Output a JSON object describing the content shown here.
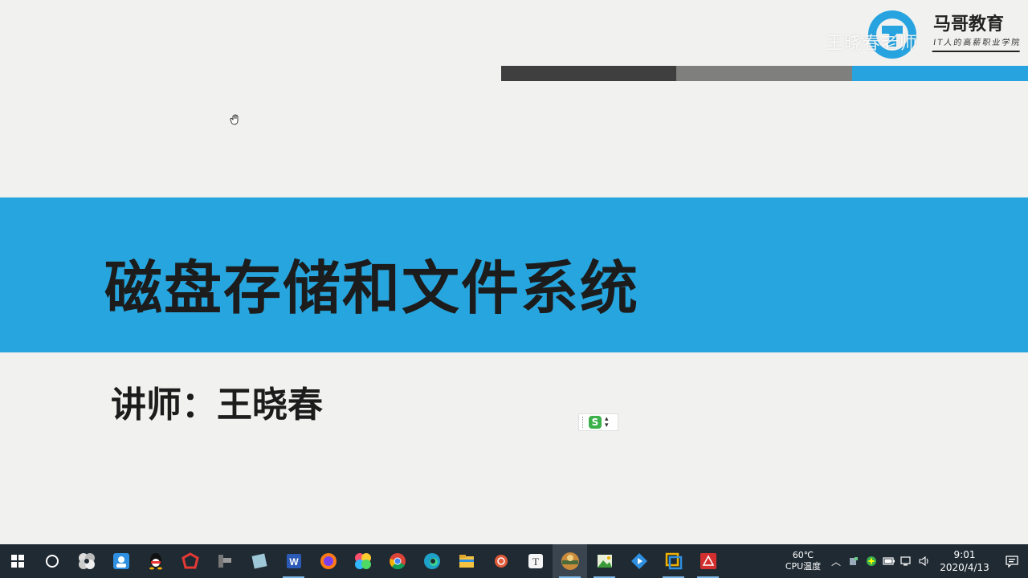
{
  "slide": {
    "title": "磁盘存储和文件系统",
    "lecturer": "讲师：王晓春",
    "watermark": "王晓春老师",
    "brand": {
      "name": "马哥教育",
      "slogan": "IT人的高薪职业学院"
    },
    "colors": {
      "band": "#27a5de",
      "bar_dark": "#3f3f3f",
      "bar_gray": "#7f7f7d",
      "bar_blue": "#27a4e0"
    }
  },
  "ime_toolbar": {
    "icon": "sogou-s-icon",
    "label": "S"
  },
  "taskbar": {
    "apps": [
      {
        "name": "start-icon"
      },
      {
        "name": "search-icon"
      },
      {
        "name": "pinwheel-app-icon"
      },
      {
        "name": "contacts-app-icon"
      },
      {
        "name": "qq-icon"
      },
      {
        "name": "red-app-icon"
      },
      {
        "name": "tool-app-icon"
      },
      {
        "name": "notes-app-icon"
      },
      {
        "name": "word-icon"
      },
      {
        "name": "firefox-icon"
      },
      {
        "name": "photos-app-icon"
      },
      {
        "name": "chrome-icon"
      },
      {
        "name": "edge-icon"
      },
      {
        "name": "file-explorer-icon"
      },
      {
        "name": "snail-app-icon"
      },
      {
        "name": "typora-icon"
      },
      {
        "name": "slideshow-app-icon"
      },
      {
        "name": "image-editor-icon"
      },
      {
        "name": "media-app-icon"
      },
      {
        "name": "vmware-icon"
      },
      {
        "name": "pdf-reader-icon"
      }
    ],
    "temperature": "60℃",
    "temperature_label": "CPU温度",
    "time": "9:01",
    "date": "2020/4/13"
  }
}
